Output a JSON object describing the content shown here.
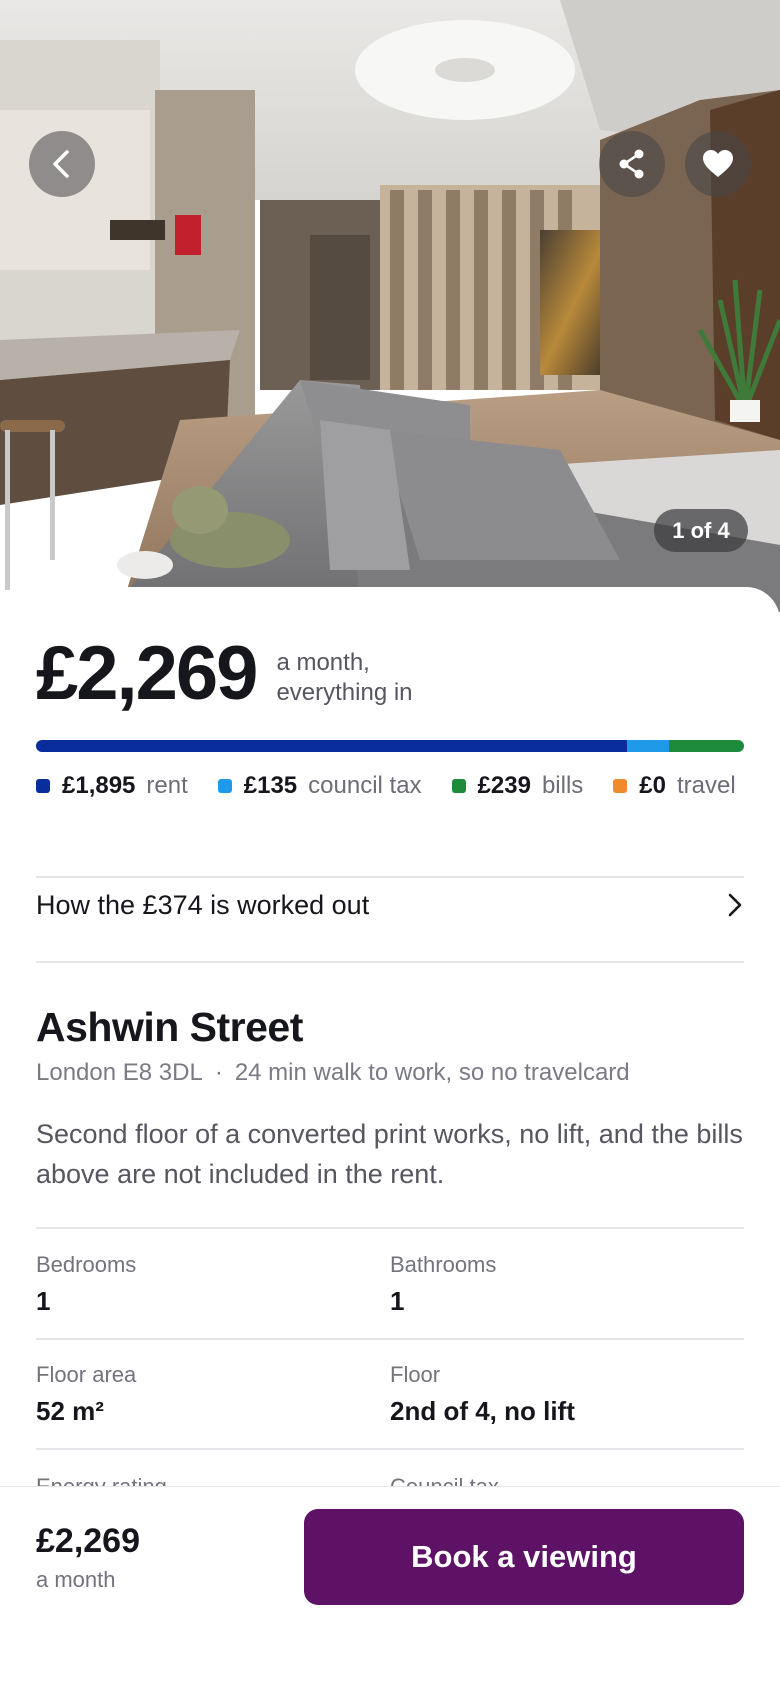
{
  "gallery": {
    "counter": "1 of 4"
  },
  "price": {
    "amount": "£2,269",
    "suffix": "a month, everything in"
  },
  "breakdown": [
    {
      "amount": "£1,895",
      "label": "rent",
      "color": "#0a2d9e",
      "value": 1895
    },
    {
      "amount": "£135",
      "label": "council tax",
      "color": "#1e9ae8",
      "value": 135
    },
    {
      "amount": "£239",
      "label": "bills",
      "color": "#1e8a3c",
      "value": 239
    },
    {
      "amount": "£0",
      "label": "travel",
      "color": "#f08a2c",
      "value": 0
    }
  ],
  "how_link": "How the £374 is worked out",
  "listing": {
    "title": "Ashwin Street",
    "postcode": "London E8 3DL",
    "separator": "·",
    "commute": "24 min walk to work, so no travelcard",
    "description": "Second floor of a converted print works, no lift, and the bills above are not included in the rent."
  },
  "specs": [
    {
      "label": "Bedrooms",
      "value": "1"
    },
    {
      "label": "Bathrooms",
      "value": "1"
    },
    {
      "label": "Floor area",
      "value": "52 m²"
    },
    {
      "label": "Floor",
      "value": "2nd of 4, no lift"
    },
    {
      "label": "Energy rating",
      "value": ""
    },
    {
      "label": "Council tax",
      "value": ""
    }
  ],
  "bottom_bar": {
    "price": "£2,269",
    "period": "a month",
    "cta": "Book a viewing",
    "cta_color": "#5d1266"
  },
  "icons": [
    "chevron-left-icon",
    "share-icon",
    "heart-icon",
    "chevron-right-icon"
  ]
}
